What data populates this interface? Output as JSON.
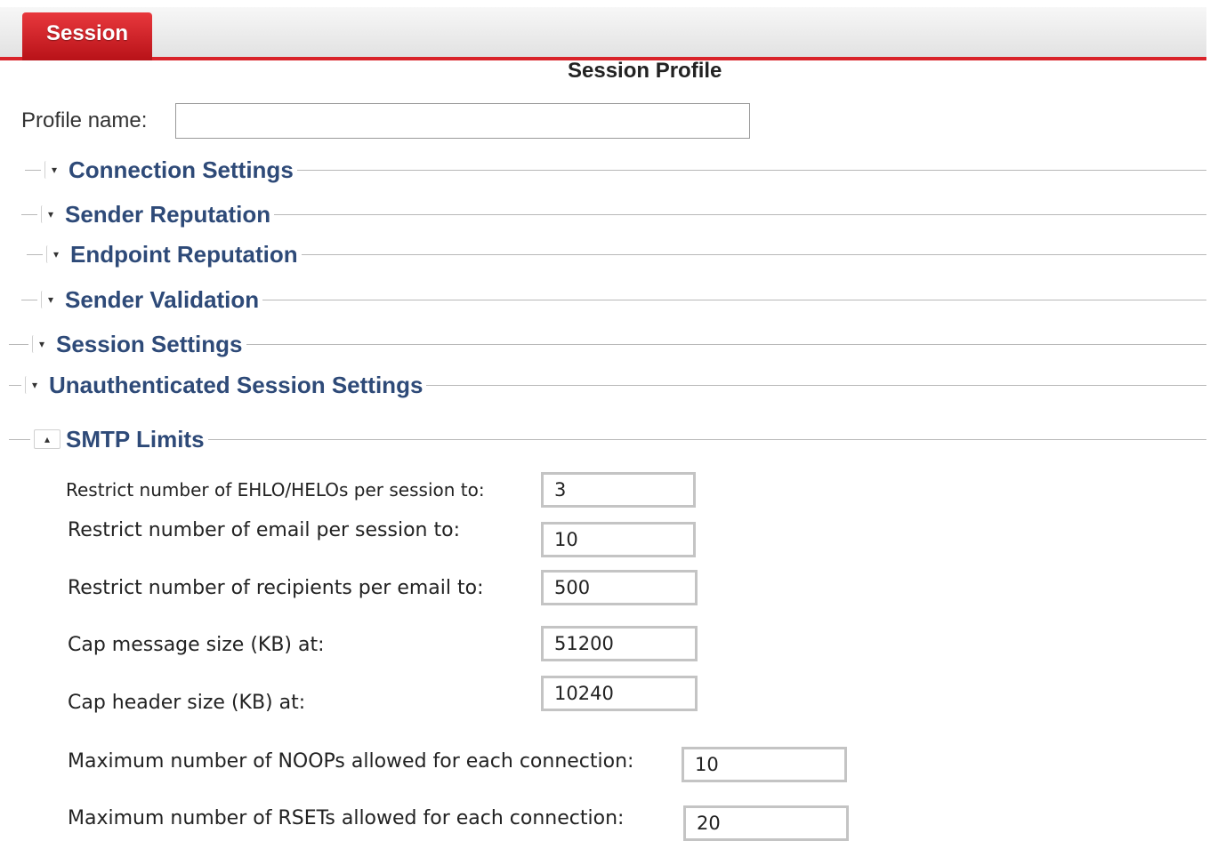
{
  "tabs": [
    {
      "label": "Session"
    }
  ],
  "page_title": "Session Profile",
  "profile": {
    "label": "Profile name:",
    "value": "",
    "placeholder": ""
  },
  "sections": [
    {
      "label": "Connection Settings",
      "state": "collapsed",
      "toggle_glyph": "▾"
    },
    {
      "label": "Sender Reputation",
      "state": "collapsed",
      "toggle_glyph": "▾"
    },
    {
      "label": "Endpoint Reputation",
      "state": "collapsed",
      "toggle_glyph": "▾"
    },
    {
      "label": "Sender Validation",
      "state": "collapsed",
      "toggle_glyph": "▾"
    },
    {
      "label": "Session Settings",
      "state": "collapsed",
      "toggle_glyph": "▾"
    },
    {
      "label": "Unauthenticated Session Settings",
      "state": "collapsed",
      "toggle_glyph": "▾"
    },
    {
      "label": "SMTP Limits",
      "state": "expanded",
      "toggle_glyph": "▴"
    }
  ],
  "smtp_limits": {
    "fields": [
      {
        "label": "Restrict number of EHLO/HELOs per session to:",
        "value": "3"
      },
      {
        "label": "Restrict number of email per session to:",
        "value": "10"
      },
      {
        "label": "Restrict number of recipients per email to:",
        "value": "500"
      },
      {
        "label": "Cap message size (KB) at:",
        "value": "51200"
      },
      {
        "label": "Cap header size (KB) at:",
        "value": "10240"
      },
      {
        "label": "Maximum number of NOOPs allowed for each connection:",
        "value": "10"
      },
      {
        "label": "Maximum number of RSETs allowed for each connection:",
        "value": "20"
      }
    ]
  },
  "colors": {
    "tab_red": "#d9232a",
    "section_heading": "#2e4a78"
  }
}
